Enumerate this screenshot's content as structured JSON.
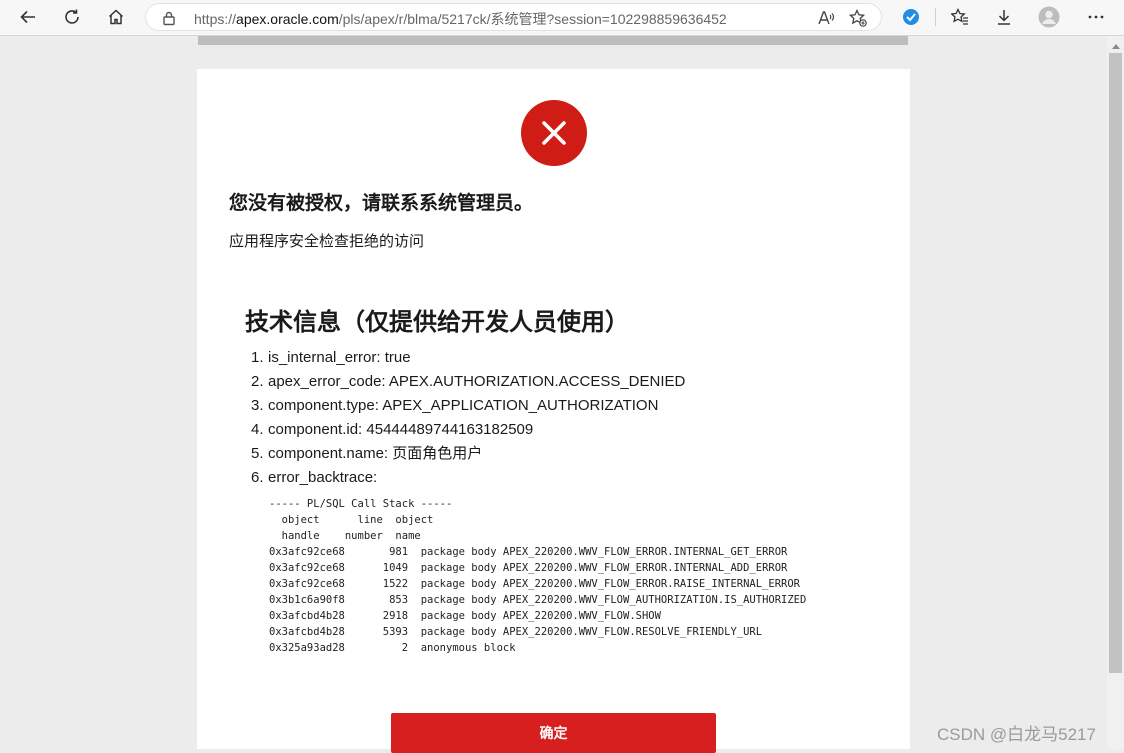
{
  "browser": {
    "url_prefix": "https://",
    "url_host": "apex.oracle.com",
    "url_path": "/pls/apex/r/blma/5217ck/系统管理?session=102298859636452",
    "icons": [
      "back-arrow-icon",
      "refresh-icon",
      "home-icon",
      "lock-icon",
      "read-aloud-icon",
      "add-favorite-icon",
      "extension-icon",
      "favorites-icon",
      "download-icon",
      "profile-avatar-icon",
      "more-icon"
    ]
  },
  "dialog": {
    "title": "您没有被授权，请联系系统管理员。",
    "subtitle": "应用程序安全检查拒绝的访问",
    "tech_heading": "技术信息（仅提供给开发人员使用）",
    "info_items": [
      {
        "num": "1.",
        "text": "is_internal_error: true"
      },
      {
        "num": "2.",
        "text": "apex_error_code: APEX.AUTHORIZATION.ACCESS_DENIED"
      },
      {
        "num": "3.",
        "text": "component.type: APEX_APPLICATION_AUTHORIZATION"
      },
      {
        "num": "4.",
        "text": "component.id: 45444489744163182509"
      },
      {
        "num": "5.",
        "text": "component.name: 页面角色用户"
      },
      {
        "num": "6.",
        "text": "error_backtrace:"
      }
    ],
    "call_stack": "----- PL/SQL Call Stack -----\n  object      line  object\n  handle    number  name\n0x3afc92ce68       981  package body APEX_220200.WWV_FLOW_ERROR.INTERNAL_GET_ERROR\n0x3afc92ce68      1049  package body APEX_220200.WWV_FLOW_ERROR.INTERNAL_ADD_ERROR\n0x3afc92ce68      1522  package body APEX_220200.WWV_FLOW_ERROR.RAISE_INTERNAL_ERROR\n0x3b1c6a90f8       853  package body APEX_220200.WWV_FLOW_AUTHORIZATION.IS_AUTHORIZED\n0x3afcbd4b28      2918  package body APEX_220200.WWV_FLOW.SHOW\n0x3afcbd4b28      5393  package body APEX_220200.WWV_FLOW.RESOLVE_FRIENDLY_URL\n0x325a93ad28         2  anonymous block",
    "ok_label": "确定"
  },
  "watermark": "CSDN @白龙马5217",
  "colors": {
    "error_red": "#cf1d15",
    "button_red": "#d71f1f",
    "page_bg": "#ececec"
  }
}
